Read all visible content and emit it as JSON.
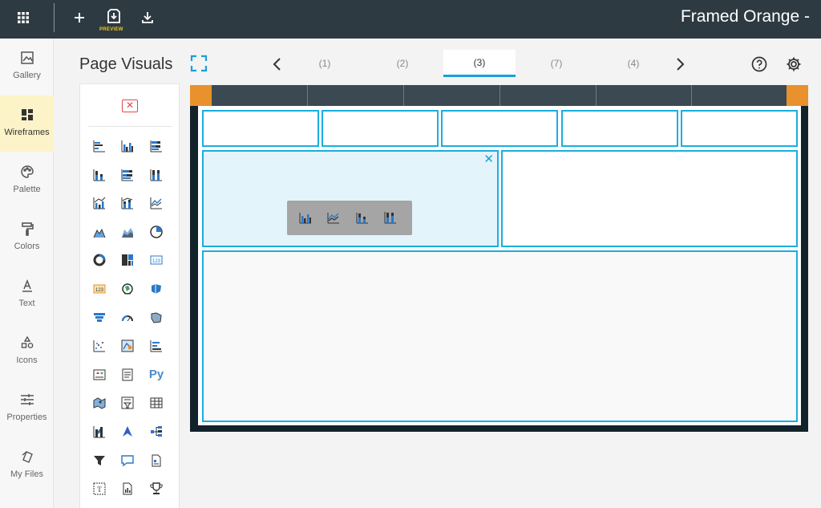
{
  "topbar": {
    "app_title": "Framed Orange -",
    "preview_label": "PREVIEW",
    "icons": [
      "apps-grid-icon",
      "plus-icon",
      "preview-download-icon",
      "download-icon"
    ]
  },
  "leftnav": {
    "items": [
      {
        "label": "Gallery",
        "icon": "gallery-icon"
      },
      {
        "label": "Wireframes",
        "icon": "wireframes-icon",
        "active": true
      },
      {
        "label": "Palette",
        "icon": "palette-icon"
      },
      {
        "label": "Colors",
        "icon": "paint-roller-icon"
      },
      {
        "label": "Text",
        "icon": "text-icon"
      },
      {
        "label": "Icons",
        "icon": "shapes-icon"
      },
      {
        "label": "Properties",
        "icon": "sliders-icon"
      },
      {
        "label": "My Files",
        "icon": "files-icon"
      }
    ]
  },
  "panel": {
    "title": "Page Visuals",
    "python_label": "Py",
    "palette_icons": [
      "clustered-bar-icon",
      "clustered-column-icon",
      "stacked-bar-icon",
      "stacked-column-icon",
      "100-stacked-bar-icon",
      "100-stacked-column-icon",
      "line-clustered-column-icon",
      "line-stacked-column-icon",
      "line-chart-icon",
      "area-chart-icon",
      "stacked-area-icon",
      "pie-chart-icon",
      "donut-chart-icon",
      "treemap-icon",
      "card-icon",
      "multi-row-card-icon",
      "globe-map-icon",
      "filled-map-icon",
      "funnel-icon",
      "gauge-icon",
      "shape-map-icon",
      "scatter-chart-icon",
      "azure-map-icon",
      "key-influencers-icon",
      "kpi-icon",
      "smart-narrative-icon",
      "python-visual-icon",
      "map-icon",
      "slicer-icon",
      "table-icon",
      "ribbon-chart-icon",
      "arcgis-icon",
      "decomposition-tree-icon",
      "filter-icon",
      "qna-icon",
      "paginated-report-icon",
      "text-box-icon",
      "report-icon",
      "trophy-icon"
    ]
  },
  "page_tabs": {
    "tabs": [
      "(1)",
      "(2)",
      "(3)",
      "(7)",
      "(4)"
    ],
    "active_index": 2
  },
  "header_icons": [
    "help-icon",
    "settings-icon"
  ],
  "canvas": {
    "chart_picker_options": [
      "clustered-column-icon",
      "line-chart-icon",
      "stacked-column-icon",
      "100-stacked-column-icon"
    ]
  },
  "colors": {
    "accent": "#1aaedf",
    "topbar": "#2e3a42",
    "frame_corner": "#e8912d",
    "active_nav": "#fdf3c8",
    "preview_tag": "#f5c518"
  }
}
